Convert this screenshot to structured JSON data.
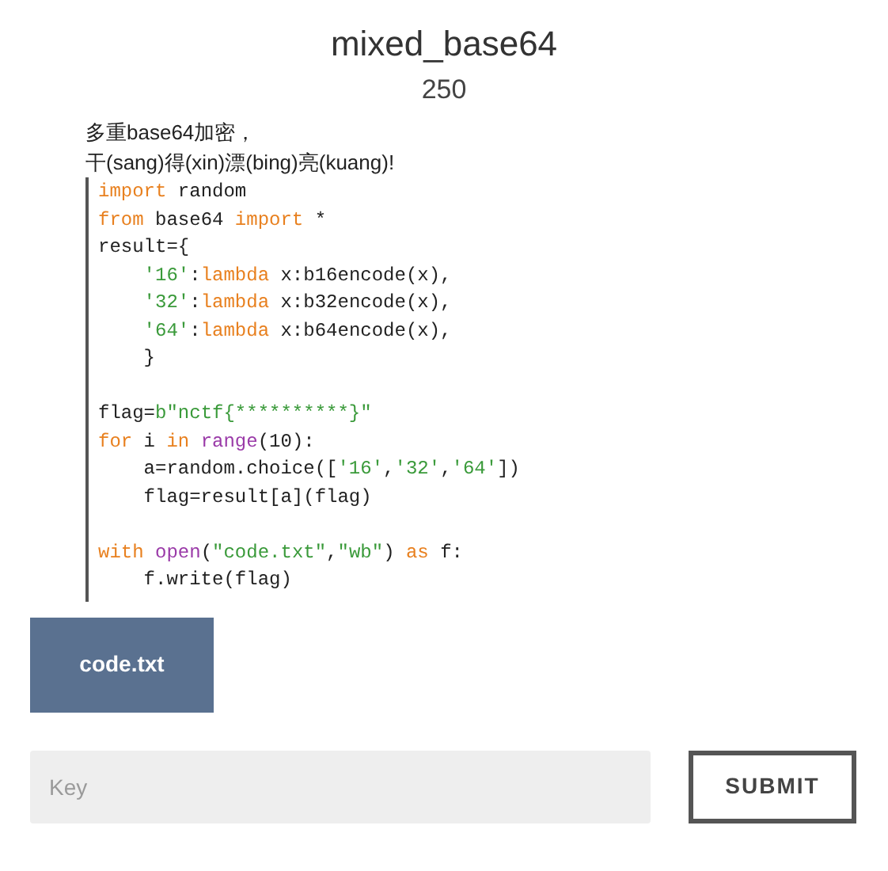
{
  "challenge": {
    "title": "mixed_base64",
    "points": "250"
  },
  "description": [
    "多重base64加密，",
    "干(sang)得(xin)漂(bing)亮(kuang)!"
  ],
  "code_lines": [
    {
      "kind": "code",
      "tokens": [
        {
          "kind": "keyword",
          "text": "import"
        },
        {
          "kind": "plain",
          "text": " random"
        }
      ]
    },
    {
      "kind": "code",
      "tokens": [
        {
          "kind": "keyword",
          "text": "from"
        },
        {
          "kind": "plain",
          "text": " base64 "
        },
        {
          "kind": "keyword",
          "text": "import"
        },
        {
          "kind": "plain",
          "text": " *"
        }
      ]
    },
    {
      "kind": "code",
      "tokens": [
        {
          "kind": "plain",
          "text": "result={"
        }
      ]
    },
    {
      "kind": "code",
      "tokens": [
        {
          "kind": "string",
          "text": "    '16'"
        },
        {
          "kind": "plain",
          "text": ":"
        },
        {
          "kind": "keyword",
          "text": "lambda"
        },
        {
          "kind": "plain",
          "text": " x:b16encode(x),"
        }
      ]
    },
    {
      "kind": "code",
      "tokens": [
        {
          "kind": "string",
          "text": "    '32'"
        },
        {
          "kind": "plain",
          "text": ":"
        },
        {
          "kind": "keyword",
          "text": "lambda"
        },
        {
          "kind": "plain",
          "text": " x:b32encode(x),"
        }
      ]
    },
    {
      "kind": "code",
      "tokens": [
        {
          "kind": "string",
          "text": "    '64'"
        },
        {
          "kind": "plain",
          "text": ":"
        },
        {
          "kind": "keyword",
          "text": "lambda"
        },
        {
          "kind": "plain",
          "text": " x:b64encode(x),"
        }
      ]
    },
    {
      "kind": "code",
      "tokens": [
        {
          "kind": "plain",
          "text": "    }"
        }
      ]
    },
    {
      "kind": "blank"
    },
    {
      "kind": "code",
      "tokens": [
        {
          "kind": "plain",
          "text": "flag="
        },
        {
          "kind": "string",
          "text": "b\"nctf{**********}\""
        }
      ]
    },
    {
      "kind": "code",
      "tokens": [
        {
          "kind": "keyword",
          "text": "for"
        },
        {
          "kind": "plain",
          "text": " i "
        },
        {
          "kind": "keyword",
          "text": "in "
        },
        {
          "kind": "builtin",
          "text": "range"
        },
        {
          "kind": "plain",
          "text": "(10):"
        }
      ]
    },
    {
      "kind": "code",
      "tokens": [
        {
          "kind": "plain",
          "text": "    a=random.choice(["
        },
        {
          "kind": "string",
          "text": "'16'"
        },
        {
          "kind": "plain",
          "text": ","
        },
        {
          "kind": "string",
          "text": "'32'"
        },
        {
          "kind": "plain",
          "text": ","
        },
        {
          "kind": "string",
          "text": "'64'"
        },
        {
          "kind": "plain",
          "text": "])"
        }
      ]
    },
    {
      "kind": "code",
      "tokens": [
        {
          "kind": "plain",
          "text": "    flag=result[a](flag)"
        }
      ]
    },
    {
      "kind": "blank"
    },
    {
      "kind": "code",
      "tokens": [
        {
          "kind": "keyword",
          "text": "with "
        },
        {
          "kind": "builtin",
          "text": "open"
        },
        {
          "kind": "plain",
          "text": "("
        },
        {
          "kind": "string",
          "text": "\"code.txt\""
        },
        {
          "kind": "plain",
          "text": ","
        },
        {
          "kind": "string",
          "text": "\"wb\""
        },
        {
          "kind": "plain",
          "text": ") "
        },
        {
          "kind": "keyword",
          "text": "as"
        },
        {
          "kind": "plain",
          "text": " f:"
        }
      ]
    },
    {
      "kind": "code",
      "tokens": [
        {
          "kind": "plain",
          "text": "    f.write(flag)"
        }
      ]
    }
  ],
  "file_button": {
    "label": "code.txt"
  },
  "key_field": {
    "placeholder": "Key"
  },
  "submit_button": {
    "label": "SUBMIT"
  }
}
